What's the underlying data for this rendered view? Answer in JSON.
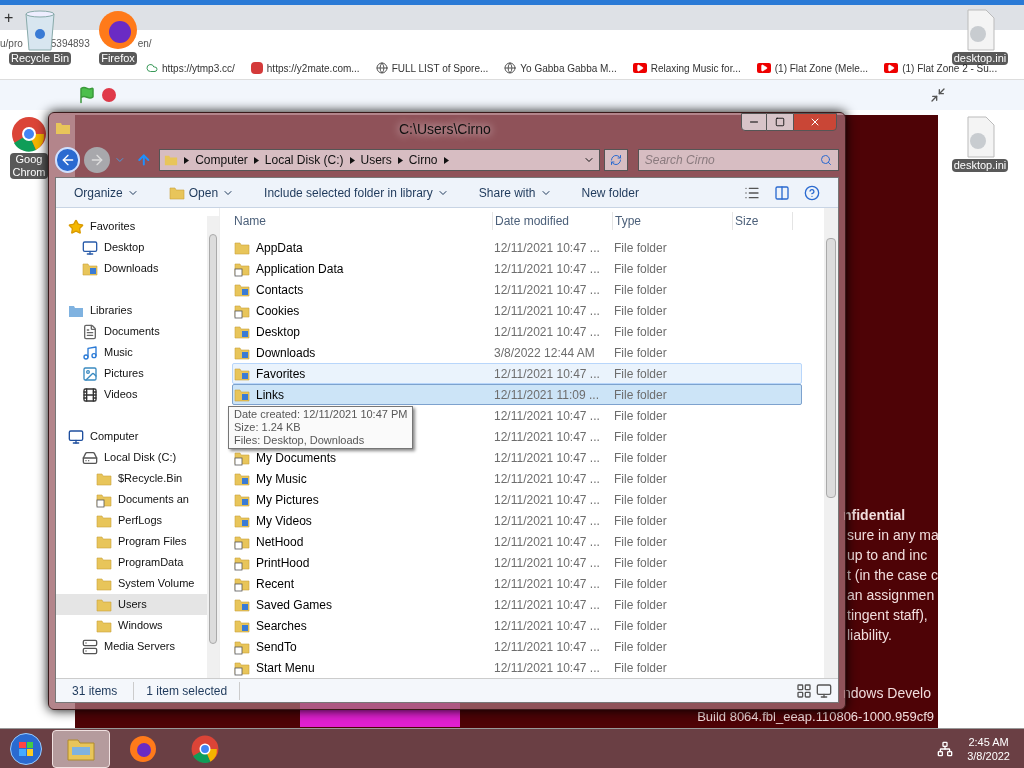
{
  "browser": {
    "new_tab": "+",
    "address_fragments": [
      "u/pro",
      "5394893",
      "en/"
    ],
    "bookmarks": [
      {
        "label": "https://ytmp3.cc/",
        "kind": "cloud"
      },
      {
        "label": "https://y2mate.com...",
        "kind": "red"
      },
      {
        "label": "FULL LIST of Spore...",
        "kind": "globe"
      },
      {
        "label": "Yo Gabba Gabba M...",
        "kind": "globe"
      },
      {
        "label": "Relaxing Music for...",
        "kind": "video"
      },
      {
        "label": "(1) Flat Zone (Mele...",
        "kind": "video"
      },
      {
        "label": "(1) Flat Zone 2 - Su...",
        "kind": "video"
      }
    ]
  },
  "desktop_icons": [
    {
      "label": "Recycle Bin",
      "kind": "bin"
    },
    {
      "label": "Firefox",
      "kind": "firefox"
    },
    {
      "label": "desktop.ini",
      "kind": "ini"
    },
    {
      "label": "Goog\nChrom",
      "kind": "chrome"
    },
    {
      "label": "desktop.ini",
      "kind": "ini"
    }
  ],
  "stage_text": {
    "heading": "nfidential",
    "lines": [
      "sure in any ma",
      "up to and inc",
      "t (in the case c",
      "an assignmen",
      "tingent staff),",
      "liability."
    ],
    "footer": "ndows Develo",
    "build": "Build 8064.fbl_eeap.110806-1000.959cf9"
  },
  "window": {
    "title": "C:\\Users\\Cirno",
    "breadcrumb": [
      "Computer",
      "Local Disk (C:)",
      "Users",
      "Cirno"
    ],
    "search": {
      "placeholder": "Search Cirno"
    },
    "commands": [
      {
        "label": "Organize",
        "menu": true,
        "icon": false
      },
      {
        "label": "Open",
        "menu": true,
        "icon": true
      },
      {
        "label": "Include selected folder in library",
        "menu": true,
        "icon": false
      },
      {
        "label": "Share with",
        "menu": true,
        "icon": false
      },
      {
        "label": "New folder",
        "menu": false,
        "icon": false
      }
    ],
    "nav": [
      {
        "label": "Favorites",
        "kind": "star",
        "selected": false,
        "children": [
          {
            "label": "Desktop",
            "kind": "desktop",
            "selected": false
          },
          {
            "label": "Downloads",
            "kind": "downloads",
            "selected": false
          }
        ]
      },
      {
        "label": "Libraries",
        "kind": "library",
        "selected": false,
        "children": [
          {
            "label": "Documents",
            "kind": "doc",
            "selected": false
          },
          {
            "label": "Music",
            "kind": "music",
            "selected": false
          },
          {
            "label": "Pictures",
            "kind": "pictures",
            "selected": false
          },
          {
            "label": "Videos",
            "kind": "videos",
            "selected": false
          }
        ]
      },
      {
        "label": "Computer",
        "kind": "computer",
        "selected": false,
        "children": [
          {
            "label": "Local Disk (C:)",
            "kind": "disk",
            "selected": false,
            "children": [
              {
                "label": "$Recycle.Bin",
                "kind": "folder",
                "selected": false
              },
              {
                "label": "Documents an",
                "kind": "shortcut",
                "selected": false
              },
              {
                "label": "PerfLogs",
                "kind": "folder",
                "selected": false
              },
              {
                "label": "Program Files",
                "kind": "folder",
                "selected": false
              },
              {
                "label": "ProgramData",
                "kind": "folder",
                "selected": false
              },
              {
                "label": "System Volume",
                "kind": "folder",
                "selected": false
              },
              {
                "label": "Users",
                "kind": "folder",
                "selected": true
              },
              {
                "label": "Windows",
                "kind": "folder",
                "selected": false
              }
            ]
          },
          {
            "label": "Media Servers",
            "kind": "media",
            "selected": false
          }
        ]
      }
    ],
    "columns": [
      "Name",
      "Date modified",
      "Type",
      "Size"
    ],
    "rows": [
      {
        "name": "AppData",
        "date": "12/11/2021 10:47 ...",
        "type": "File folder",
        "kind": "folder",
        "selected": false,
        "hovered": false
      },
      {
        "name": "Application Data",
        "date": "12/11/2021 10:47 ...",
        "type": "File folder",
        "kind": "shortcut",
        "selected": false,
        "hovered": false
      },
      {
        "name": "Contacts",
        "date": "12/11/2021 10:47 ...",
        "type": "File folder",
        "kind": "special",
        "selected": false,
        "hovered": false
      },
      {
        "name": "Cookies",
        "date": "12/11/2021 10:47 ...",
        "type": "File folder",
        "kind": "shortcut",
        "selected": false,
        "hovered": false
      },
      {
        "name": "Desktop",
        "date": "12/11/2021 10:47 ...",
        "type": "File folder",
        "kind": "special",
        "selected": false,
        "hovered": false
      },
      {
        "name": "Downloads",
        "date": "3/8/2022 12:44 AM",
        "type": "File folder",
        "kind": "special",
        "selected": false,
        "hovered": false
      },
      {
        "name": "Favorites",
        "date": "12/11/2021 10:47 ...",
        "type": "File folder",
        "kind": "special",
        "selected": false,
        "hovered": true
      },
      {
        "name": "Links",
        "date": "12/11/2021 11:09 ...",
        "type": "File folder",
        "kind": "special",
        "selected": true,
        "hovered": false
      },
      {
        "date": "12/11/2021 10:47 ...",
        "type": "File folder",
        "selected": false,
        "hovered": false
      },
      {
        "date": "12/11/2021 10:47 ...",
        "type": "File folder",
        "selected": false,
        "hovered": false
      },
      {
        "name": "My Documents",
        "date": "12/11/2021 10:47 ...",
        "type": "File folder",
        "kind": "shortcut",
        "selected": false,
        "hovered": false
      },
      {
        "name": "My Music",
        "date": "12/11/2021 10:47 ...",
        "type": "File folder",
        "kind": "special",
        "selected": false,
        "hovered": false
      },
      {
        "name": "My Pictures",
        "date": "12/11/2021 10:47 ...",
        "type": "File folder",
        "kind": "special",
        "selected": false,
        "hovered": false
      },
      {
        "name": "My Videos",
        "date": "12/11/2021 10:47 ...",
        "type": "File folder",
        "kind": "special",
        "selected": false,
        "hovered": false
      },
      {
        "name": "NetHood",
        "date": "12/11/2021 10:47 ...",
        "type": "File folder",
        "kind": "shortcut",
        "selected": false,
        "hovered": false
      },
      {
        "name": "PrintHood",
        "date": "12/11/2021 10:47 ...",
        "type": "File folder",
        "kind": "shortcut",
        "selected": false,
        "hovered": false
      },
      {
        "name": "Recent",
        "date": "12/11/2021 10:47 ...",
        "type": "File folder",
        "kind": "shortcut",
        "selected": false,
        "hovered": false
      },
      {
        "name": "Saved Games",
        "date": "12/11/2021 10:47 ...",
        "type": "File folder",
        "kind": "special",
        "selected": false,
        "hovered": false
      },
      {
        "name": "Searches",
        "date": "12/11/2021 10:47 ...",
        "type": "File folder",
        "kind": "special",
        "selected": false,
        "hovered": false
      },
      {
        "name": "SendTo",
        "date": "12/11/2021 10:47 ...",
        "type": "File folder",
        "kind": "shortcut",
        "selected": false,
        "hovered": false
      },
      {
        "name": "Start Menu",
        "date": "12/11/2021 10:47 ...",
        "type": "File folder",
        "kind": "shortcut",
        "selected": false,
        "hovered": false
      }
    ],
    "tooltip": [
      "Date created: 12/11/2021 10:47 PM",
      "Size: 1.24 KB",
      "Files: Desktop, Downloads"
    ],
    "status": {
      "count": "31 items",
      "selection": "1 item selected"
    }
  },
  "taskbar": {
    "apps": [
      {
        "kind": "explorer",
        "active": true
      },
      {
        "kind": "firefox",
        "active": false
      },
      {
        "kind": "chrome",
        "active": false
      }
    ],
    "time": "2:45 AM",
    "date": "3/8/2022"
  }
}
